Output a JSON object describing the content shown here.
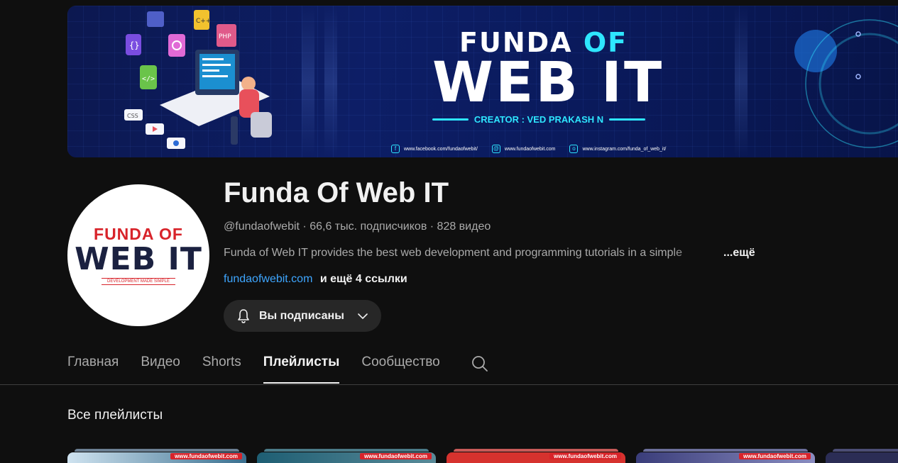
{
  "banner": {
    "title_top_a": "FUNDA ",
    "title_top_b": "OF",
    "title_main": "WEB IT",
    "creator": "CREATOR : VED PRAKASH N",
    "links": [
      {
        "icon": "facebook-icon",
        "text": "www.facebook.com/fundaofwebit/"
      },
      {
        "icon": "web-icon",
        "text": "www.fundaofwebit.com"
      },
      {
        "icon": "instagram-icon",
        "text": "www.instagram.com/funda_of_web_it/"
      }
    ],
    "art_labels": [
      "C++",
      "PHP",
      "CSS"
    ]
  },
  "avatar": {
    "line1": "FUNDA OF",
    "line2": "WEB IT",
    "line3": "DEVELOPMENT MADE SIMPLE"
  },
  "channel": {
    "name": "Funda Of Web IT",
    "meta": "@fundaofwebit · 66,6 тыс. подписчиков · 828 видео",
    "description": "Funda of Web IT provides the best web development and programming tutorials in a simple",
    "description_more": "...ещё",
    "link_url": "fundaofwebit.com",
    "link_more": "и ещё 4 ссылки",
    "subscribe_label": "Вы подписаны"
  },
  "tabs": [
    {
      "label": "Главная",
      "active": false
    },
    {
      "label": "Видео",
      "active": false
    },
    {
      "label": "Shorts",
      "active": false
    },
    {
      "label": "Плейлисты",
      "active": true
    },
    {
      "label": "Сообщество",
      "active": false
    }
  ],
  "section": {
    "title": "Все плейлисты"
  },
  "playlists": [
    {
      "watermark": "www.fundaofwebit.com",
      "color": "#3b6f8f",
      "stack": "#6b7f92"
    },
    {
      "watermark": "www.fundaofwebit.com",
      "color": "#1e5e73",
      "stack": "#4a7a88"
    },
    {
      "watermark": "www.fundaofwebit.com",
      "color": "#d6322e",
      "stack": "#c85a58"
    },
    {
      "watermark": "www.fundaofwebit.com",
      "color": "#3a3d7a",
      "stack": "#6b6e9a"
    },
    {
      "watermark": "",
      "color": "#2b2d55",
      "stack": "#4b4d75"
    }
  ],
  "colors": {
    "background": "#0f0f0f",
    "link": "#3ea6ff",
    "muted": "#aaaaaa",
    "accent_cyan": "#2ee6ff",
    "brand_red": "#d8232a"
  }
}
